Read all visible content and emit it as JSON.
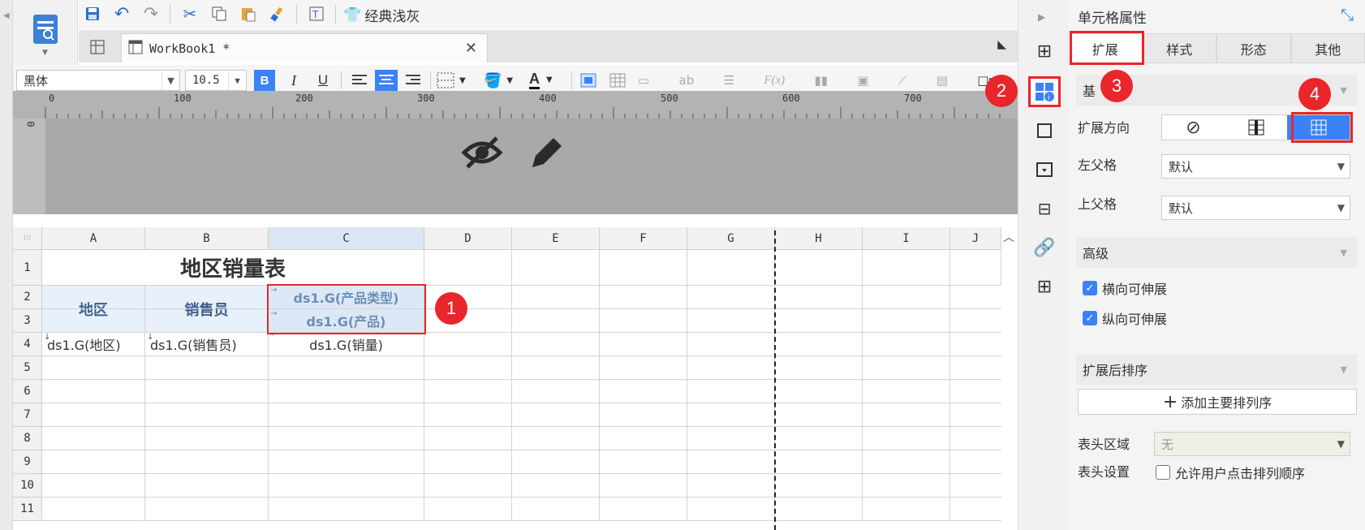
{
  "toolbar": {
    "theme_label": "经典浅灰"
  },
  "tab": {
    "title": "WorkBook1 *"
  },
  "format": {
    "font_name": "黑体",
    "font_size": "10.5"
  },
  "ruler": {
    "ticks": [
      "0",
      "100",
      "200",
      "300",
      "400",
      "500",
      "600",
      "700"
    ]
  },
  "grid": {
    "columns": [
      "A",
      "B",
      "C",
      "D",
      "E",
      "F",
      "G",
      "H",
      "I",
      "J"
    ],
    "rows": [
      "1",
      "2",
      "3",
      "4",
      "5",
      "6",
      "7",
      "8",
      "9",
      "10",
      "11"
    ],
    "title": "地区销量表",
    "header_region": "地区",
    "header_salesperson": "销售员",
    "c2": "ds1.G(产品类型)",
    "c3": "ds1.G(产品)",
    "a4": "ds1.G(地区)",
    "b4": "ds1.G(销售员)",
    "c4": "ds1.G(销量)"
  },
  "panel": {
    "title": "单元格属性",
    "tabs": [
      "扩展",
      "样式",
      "形态",
      "其他"
    ],
    "basic_label": "基",
    "expand_direction_label": "扩展方向",
    "left_parent_label": "左父格",
    "left_parent_value": "默认",
    "top_parent_label": "上父格",
    "top_parent_value": "默认",
    "advanced_label": "高级",
    "horizontal_stretch": "横向可伸展",
    "vertical_stretch": "纵向可伸展",
    "sort_after_expand": "扩展后排序",
    "add_sort_button": "添加主要排列序",
    "header_area_label": "表头区域",
    "header_area_value": "无",
    "header_settings_label": "表头设置",
    "allow_click_sort": "允许用户点击排列顺序"
  },
  "badges": [
    "1",
    "2",
    "3",
    "4"
  ],
  "colors": {
    "accent_blue": "#3b82f6",
    "highlight_red": "#e8262b"
  }
}
